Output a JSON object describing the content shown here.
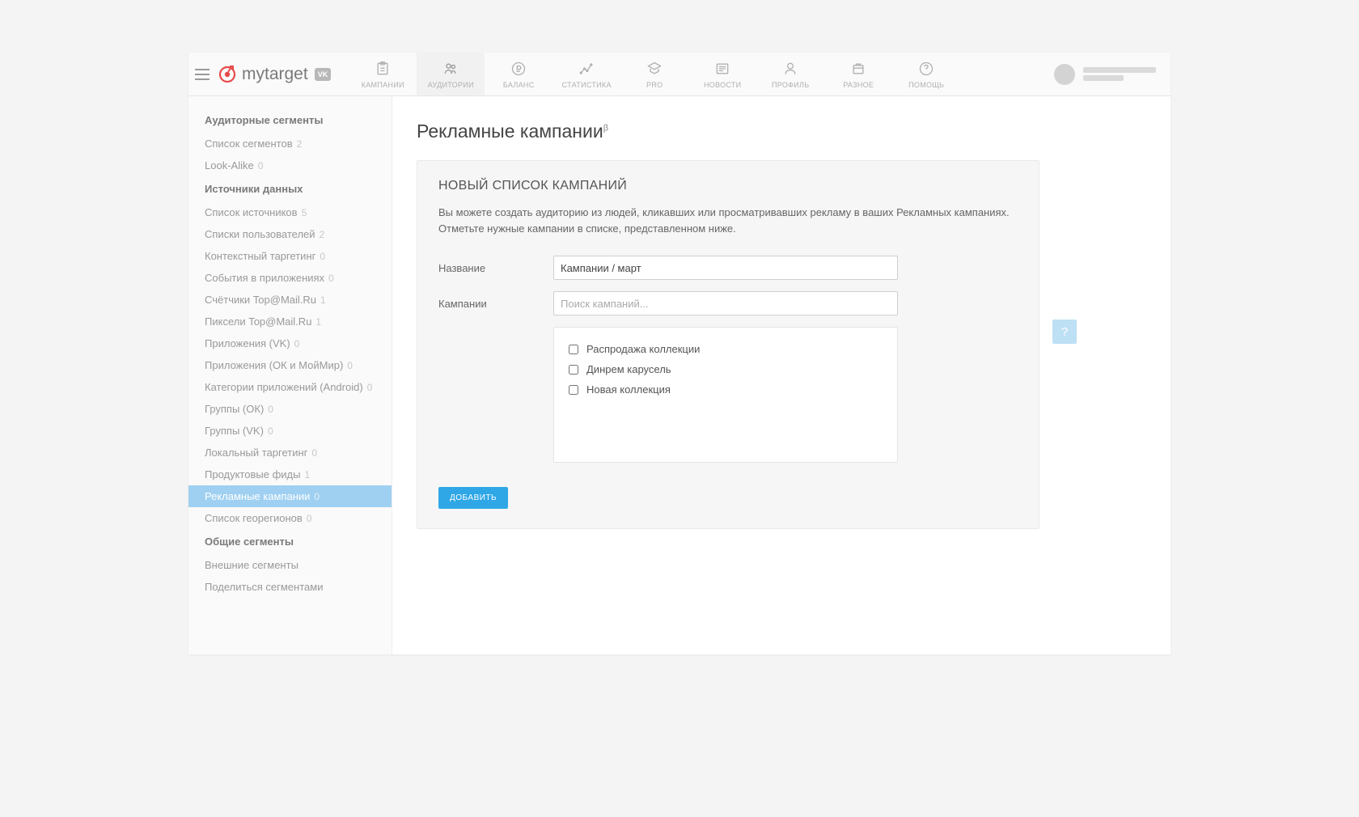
{
  "logo": {
    "text": "mytarget",
    "badge": "VK"
  },
  "nav": [
    {
      "label": "КАМПАНИИ"
    },
    {
      "label": "АУДИТОРИИ"
    },
    {
      "label": "БАЛАНС"
    },
    {
      "label": "СТАТИСТИКА"
    },
    {
      "label": "PRO"
    },
    {
      "label": "НОВОСТИ"
    },
    {
      "label": "ПРОФИЛЬ"
    },
    {
      "label": "РАЗНОЕ"
    },
    {
      "label": "ПОМОЩЬ"
    }
  ],
  "sidebar": {
    "section1": {
      "heading": "Аудиторные сегменты"
    },
    "items1": [
      {
        "label": "Список сегментов",
        "count": "2"
      },
      {
        "label": "Look-Alike",
        "count": "0"
      }
    ],
    "section2": {
      "heading": "Источники данных"
    },
    "items2": [
      {
        "label": "Список источников",
        "count": "5"
      },
      {
        "label": "Списки пользователей",
        "count": "2"
      },
      {
        "label": "Контекстный таргетинг",
        "count": "0"
      },
      {
        "label": "События в приложениях",
        "count": "0"
      },
      {
        "label": "Счётчики Top@Mail.Ru",
        "count": "1"
      },
      {
        "label": "Пиксели Top@Mail.Ru",
        "count": "1"
      },
      {
        "label": "Приложения (VK)",
        "count": "0"
      },
      {
        "label": "Приложения (ОК и МойМир)",
        "count": "0"
      },
      {
        "label": "Категории приложений (Android)",
        "count": "0"
      },
      {
        "label": "Группы (ОК)",
        "count": "0"
      },
      {
        "label": "Группы (VK)",
        "count": "0"
      },
      {
        "label": "Локальный таргетинг",
        "count": "0"
      },
      {
        "label": "Продуктовые фиды",
        "count": "1"
      },
      {
        "label": "Рекламные кампании",
        "count": "0"
      },
      {
        "label": "Список георегионов",
        "count": "0"
      }
    ],
    "section3": {
      "heading": "Общие сегменты"
    },
    "items3": [
      {
        "label": "Внешние сегменты"
      },
      {
        "label": "Поделиться сегментами"
      }
    ]
  },
  "main": {
    "title": "Рекламные кампании",
    "beta": "β",
    "panel_title": "НОВЫЙ СПИСОК КАМПАНИЙ",
    "panel_desc": "Вы можете создать аудиторию из людей, кликавших или просматривавших рекламу в ваших Рекламных кампаниях. Отметьте нужные кампании в списке, представленном ниже.",
    "name_label": "Название",
    "name_value": "Кампании / март",
    "campaigns_label": "Кампании",
    "search_placeholder": "Поиск кампаний...",
    "campaigns": [
      {
        "label": "Распродажа коллекции"
      },
      {
        "label": "Динрем карусель"
      },
      {
        "label": "Новая коллекция"
      }
    ],
    "add_button": "ДОБАВИТЬ"
  },
  "help_fab": "?"
}
